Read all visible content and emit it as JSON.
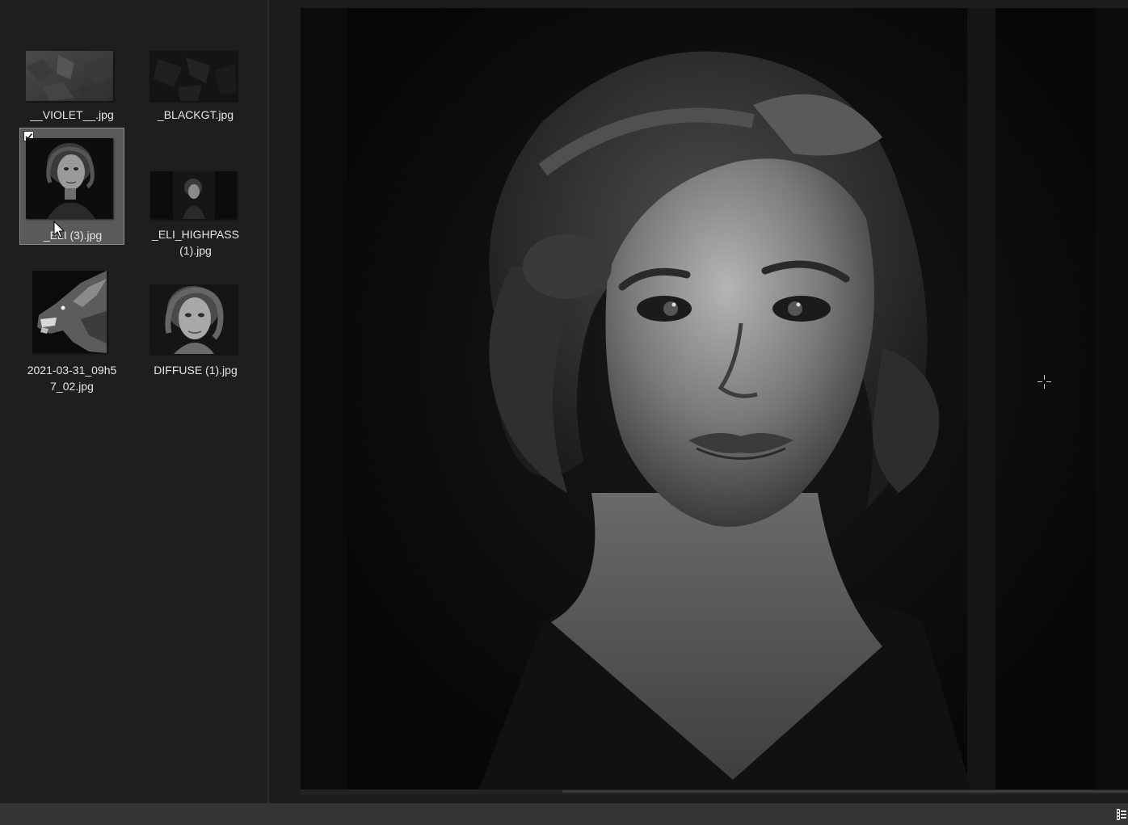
{
  "file_browser": {
    "items": [
      {
        "name": "__VIOLET__.jpg",
        "selected": false,
        "thumbnail": "dark-texture"
      },
      {
        "name": "_BLACKGT.jpg",
        "selected": false,
        "thumbnail": "black-texture"
      },
      {
        "name": "_ELI (3).jpg",
        "selected": true,
        "thumbnail": "woman-portrait"
      },
      {
        "name": "_ELI_HIGHPASS (1).jpg",
        "selected": false,
        "thumbnail": "woman-portrait-small"
      },
      {
        "name": "2021-03-31_09h57_02.jpg",
        "selected": false,
        "thumbnail": "wolf-head"
      },
      {
        "name": "DIFFUSE (1).jpg",
        "selected": false,
        "thumbnail": "woman-portrait-color"
      }
    ],
    "labels": {
      "item0": "__VIOLET__.jpg",
      "item1": "_BLACKGT.jpg",
      "item2": "_ELI (3).jpg",
      "item3_line1": "_ELI_HIGHPASS",
      "item3_line2": "(1).jpg",
      "item4_line1": "2021-03-31_09h5",
      "item4_line2": "7_02.jpg",
      "item5": "DIFFUSE (1).jpg"
    }
  },
  "preview": {
    "image": "woman-portrait-grayscale",
    "cursor": "crosshair-icon"
  },
  "colors": {
    "panel_bg": "#1e1e1e",
    "preview_bg": "#0e0e0e",
    "selection_bg": "#5a5a5a",
    "status_bar": "#343434",
    "text": "#e6e6e6"
  }
}
